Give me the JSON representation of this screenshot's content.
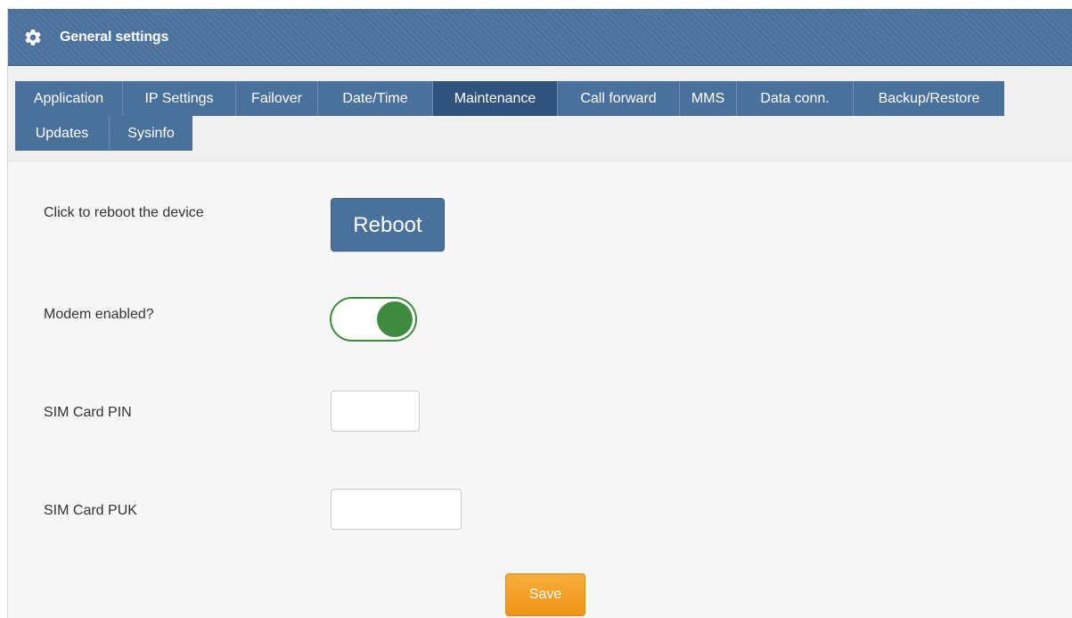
{
  "header": {
    "title": "General settings",
    "icon": "gear-icon"
  },
  "tabs": [
    {
      "label": "Application"
    },
    {
      "label": "IP Settings"
    },
    {
      "label": "Failover"
    },
    {
      "label": "Date/Time"
    },
    {
      "label": "Maintenance",
      "active": true
    },
    {
      "label": "Call forward"
    },
    {
      "label": "MMS"
    },
    {
      "label": "Data conn."
    },
    {
      "label": "Backup/Restore"
    },
    {
      "label": "Updates"
    },
    {
      "label": "Sysinfo"
    }
  ],
  "form": {
    "reboot_label": "Click to reboot the device",
    "reboot_button": "Reboot",
    "modem_label": "Modem enabled?",
    "modem_enabled": true,
    "sim_pin_label": "SIM Card PIN",
    "sim_pin_value": "",
    "sim_puk_label": "SIM Card PUK",
    "sim_puk_value": "",
    "save_button": "Save"
  },
  "colors": {
    "header_bg": "#4a719c",
    "tab_active_bg": "#2f537c",
    "toggle_on": "#3e8a3e",
    "save_bg": "#f39c1f"
  }
}
